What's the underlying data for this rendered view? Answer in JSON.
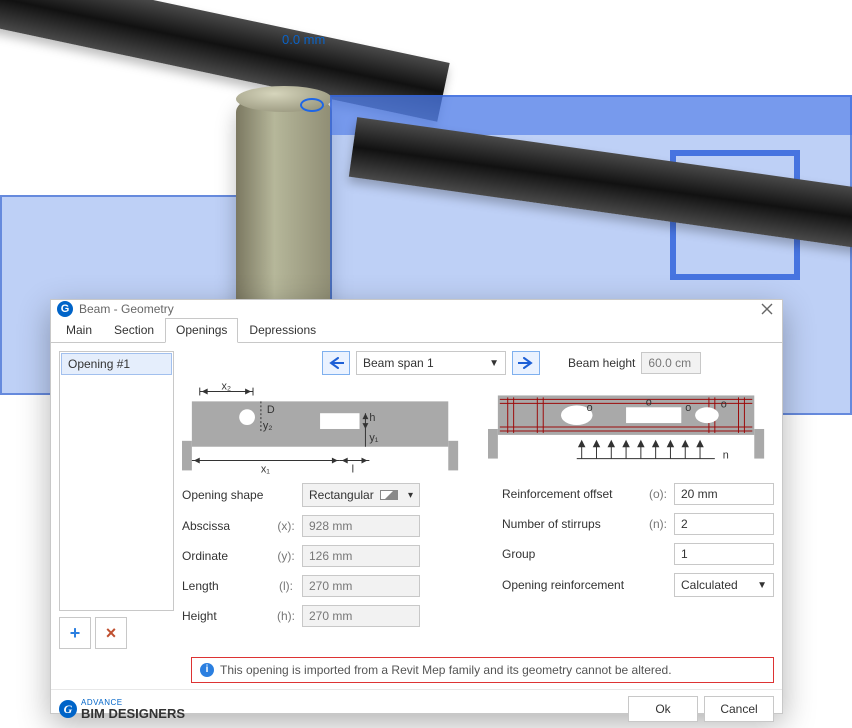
{
  "viewport": {
    "dimension_label": "0.0 mm"
  },
  "dialog": {
    "title": "Beam - Geometry",
    "tabs": [
      "Main",
      "Section",
      "Openings",
      "Depressions"
    ],
    "active_tab_index": 2,
    "list": {
      "items": [
        "Opening #1"
      ],
      "selected_index": 0
    },
    "add_tooltip": "Add opening",
    "del_tooltip": "Delete opening",
    "span_selector": {
      "prev_label": "◄",
      "next_label": "►",
      "value": "Beam span 1"
    },
    "beam_height": {
      "label": "Beam height",
      "value": "60.0 cm"
    },
    "left_params": {
      "shape": {
        "label": "Opening shape",
        "value": "Rectangular"
      },
      "abscissa": {
        "label": "Abscissa",
        "tag": "(x):",
        "value": "928 mm"
      },
      "ordinate": {
        "label": "Ordinate",
        "tag": "(y):",
        "value": "126 mm"
      },
      "length": {
        "label": "Length",
        "tag": "(l):",
        "value": "270 mm"
      },
      "height": {
        "label": "Height",
        "tag": "(h):",
        "value": "270 mm"
      }
    },
    "right_params": {
      "offset": {
        "label": "Reinforcement offset",
        "tag": "(o):",
        "value": "20 mm"
      },
      "stirrup": {
        "label": "Number of stirrups",
        "tag": "(n):",
        "value": "2"
      },
      "group": {
        "label": "Group",
        "tag": "",
        "value": "1"
      },
      "reinforce": {
        "label": "Opening reinforcement",
        "value": "Calculated"
      }
    },
    "diagram_labels": {
      "x1": "x₁",
      "x2": "x₂",
      "y1": "y₁",
      "y2": "y₂",
      "D": "D",
      "h": "h",
      "l": "l",
      "o": "o",
      "n": "n"
    },
    "notice": "This opening is imported from a Revit Mep family and its geometry cannot be altered.",
    "footer": {
      "brand_small": "ADVANCE",
      "brand": "BIM DESIGNERS",
      "ok": "Ok",
      "cancel": "Cancel"
    }
  }
}
